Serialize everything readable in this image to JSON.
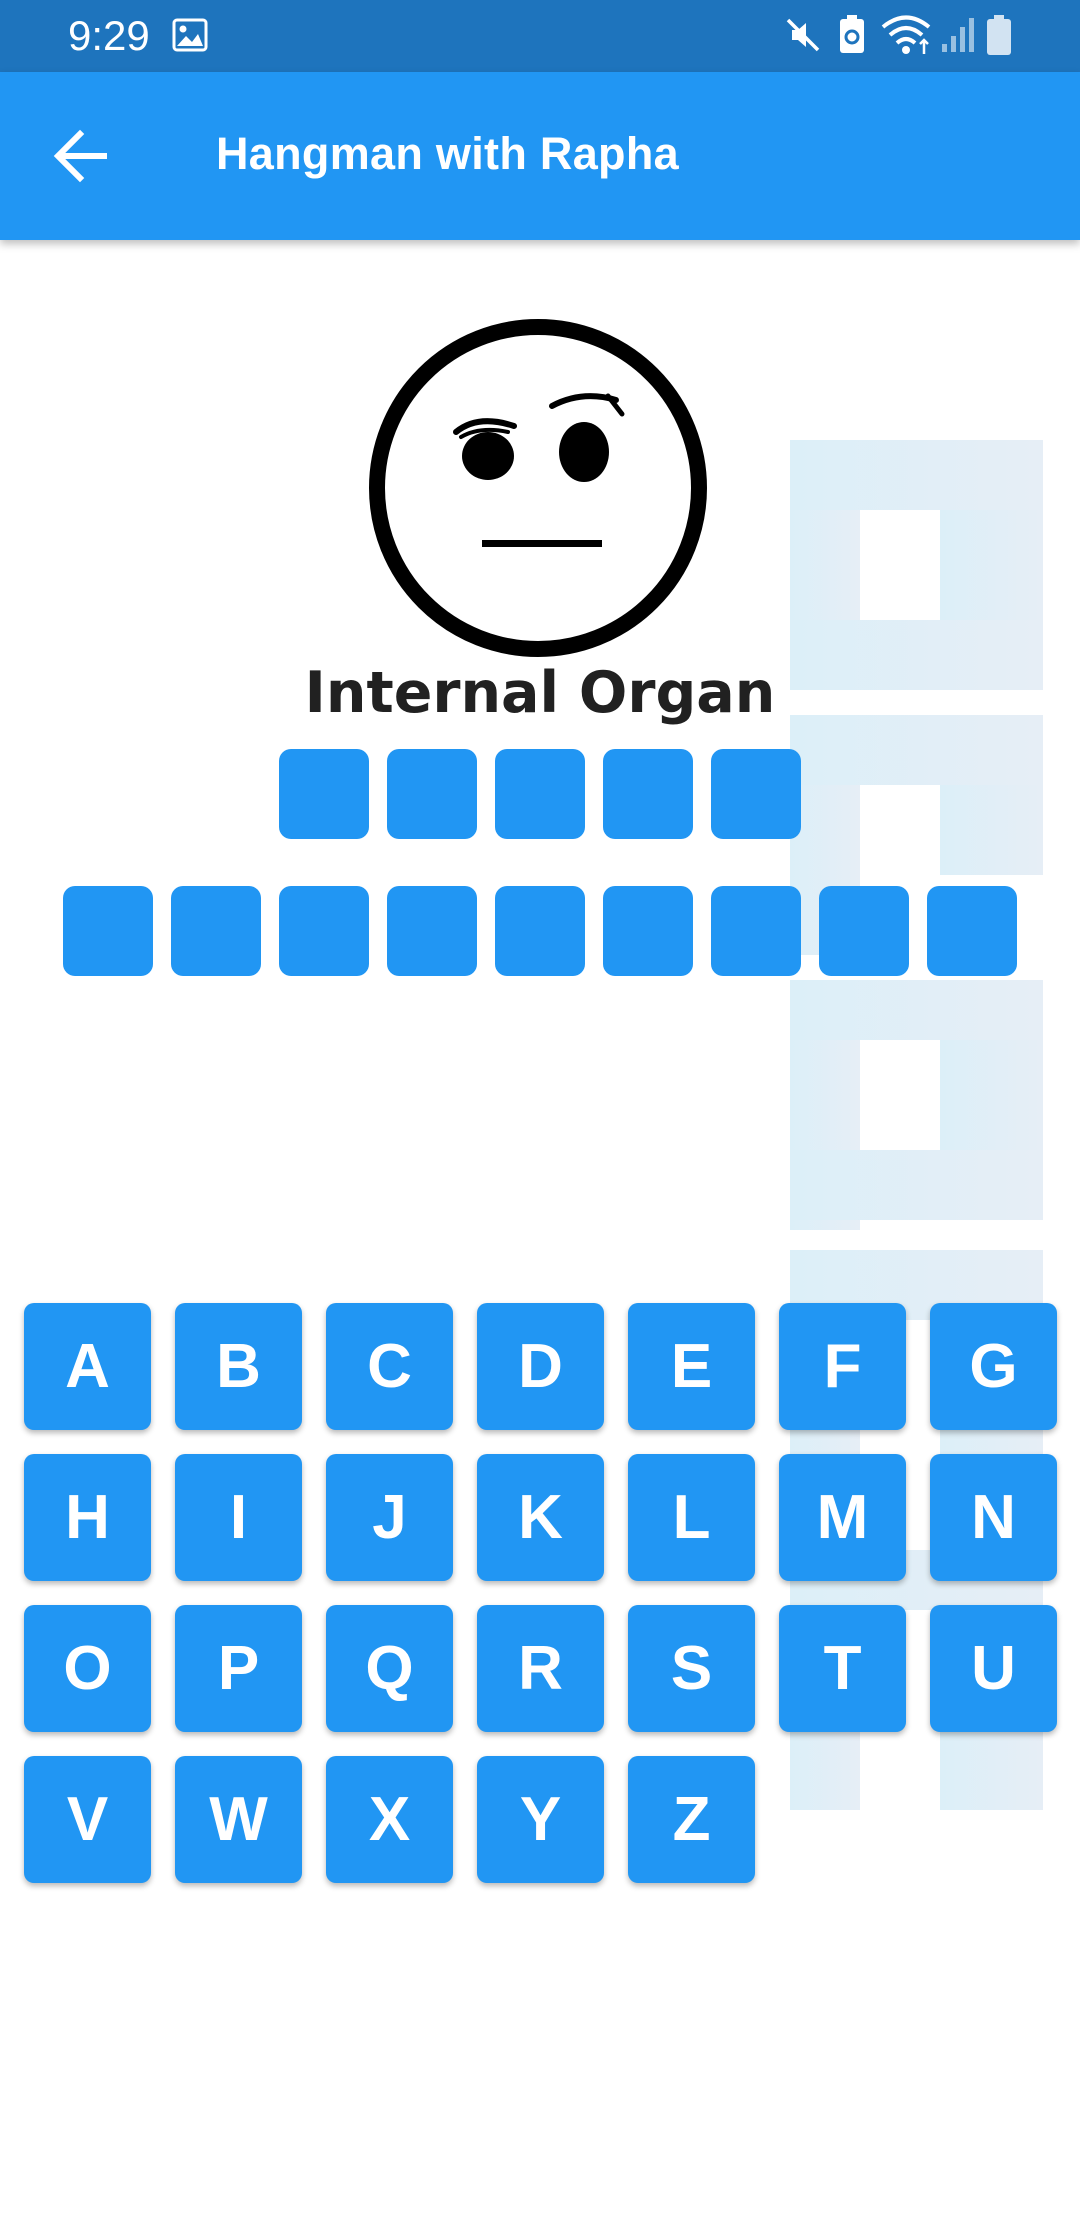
{
  "status_bar": {
    "time": "9:29",
    "icons": [
      "image-icon",
      "mute-icon",
      "battery-saver-icon",
      "wifi-icon",
      "signal-icon",
      "battery-icon"
    ]
  },
  "app_bar": {
    "back_icon": "arrow-back-icon",
    "title": "Hangman with Rapha"
  },
  "game": {
    "face": "skeptical-face",
    "category": "Internal Organ",
    "word_rows": [
      {
        "letters": [
          "",
          "",
          "",
          "",
          ""
        ]
      },
      {
        "letters": [
          "",
          "",
          "",
          "",
          "",
          "",
          "",
          "",
          ""
        ]
      }
    ]
  },
  "keyboard": {
    "keys": [
      "A",
      "B",
      "C",
      "D",
      "E",
      "F",
      "G",
      "H",
      "I",
      "J",
      "K",
      "L",
      "M",
      "N",
      "O",
      "P",
      "Q",
      "R",
      "S",
      "T",
      "U",
      "V",
      "W",
      "X",
      "Y",
      "Z"
    ]
  },
  "colors": {
    "primary": "#2196F3",
    "status_bar": "#1E74BD",
    "text_dark": "#212121",
    "watermark": "#D6EAF5"
  }
}
